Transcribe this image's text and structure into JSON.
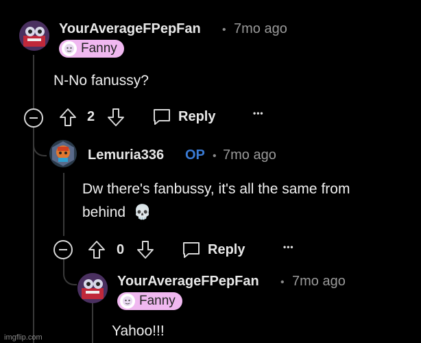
{
  "comments": [
    {
      "username": "YourAverageFPepFan",
      "separator": "•",
      "time": "7mo ago",
      "flair": "Fanny",
      "body": [
        "N-No fanussy?"
      ],
      "votes": "2",
      "reply_label": "Reply",
      "more_label": "•••"
    },
    {
      "username": "Lemuria336",
      "op_badge": "OP",
      "separator": "•",
      "time": "7mo ago",
      "body": [
        "Dw there's fanbussy, it's all the same from",
        "behind"
      ],
      "emoji": "💀",
      "votes": "0",
      "reply_label": "Reply",
      "more_label": "•••"
    },
    {
      "username": "YourAverageFPepFan",
      "separator": "•",
      "time": "7mo ago",
      "flair": "Fanny",
      "body": [
        "Yahoo!!!"
      ]
    }
  ],
  "watermark": "imgflip.com",
  "icons": {
    "collapse": "minus-circle-icon",
    "upvote": "upvote-arrow-icon",
    "downvote": "downvote-arrow-icon",
    "reply": "speech-bubble-icon",
    "avatar": "user-avatar-icon",
    "flair_face": "flair-face-icon"
  },
  "colors": {
    "background": "#000000",
    "thread_line": "#3a3a3a",
    "op_badge": "#3a7bd5",
    "flair_bg": "#f0b8f0"
  }
}
